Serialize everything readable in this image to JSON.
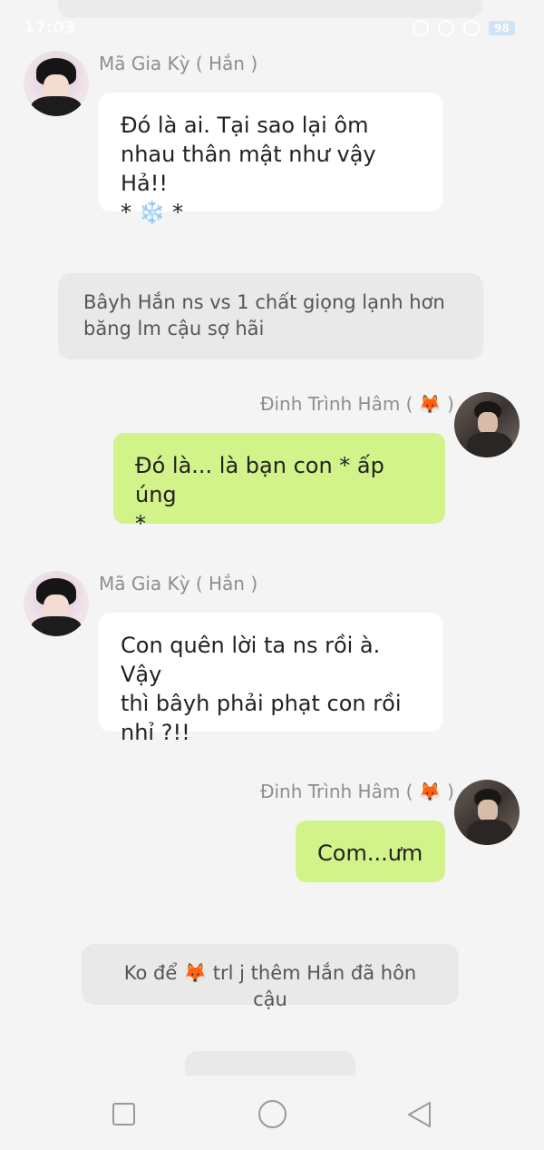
{
  "status_bar": {
    "time": "17:03",
    "battery": "98"
  },
  "characters": {
    "han": {
      "name": "Mã Gia Kỳ ( Hắn )"
    },
    "dinh": {
      "name": "Đinh Trình Hâm ( 🦊 )"
    }
  },
  "messages": [
    {
      "sender": "han",
      "text": "Đó là ai. Tại sao lại ôm\nnhau thân mật như vậy Hả!!\n* ❄️ *"
    },
    {
      "type": "narration",
      "text": "Bâyh Hắn ns vs 1 chất giọng lạnh hơn\nbăng lm cậu sợ hãi"
    },
    {
      "sender": "dinh",
      "text": "Đó là... là bạn con * ấp úng\n*"
    },
    {
      "sender": "han",
      "text": "Con quên lời ta ns rồi à. Vậy\nthì bâyh phải phạt con rồi\nnhỉ ?!!"
    },
    {
      "sender": "dinh",
      "text": "Com...ưm"
    },
    {
      "type": "narration",
      "text": "Ko để 🦊 trl j thêm Hắn đã hôn cậu"
    }
  ],
  "colors": {
    "background": "#f4f4f4",
    "bubble_left": "#ffffff",
    "bubble_right": "#d2f28a",
    "narration": "#e9e9e9",
    "name_text": "#8e8e8e"
  },
  "nav": {
    "recent_icon": "square-icon",
    "home_icon": "circle-icon",
    "back_icon": "triangle-back-icon"
  }
}
